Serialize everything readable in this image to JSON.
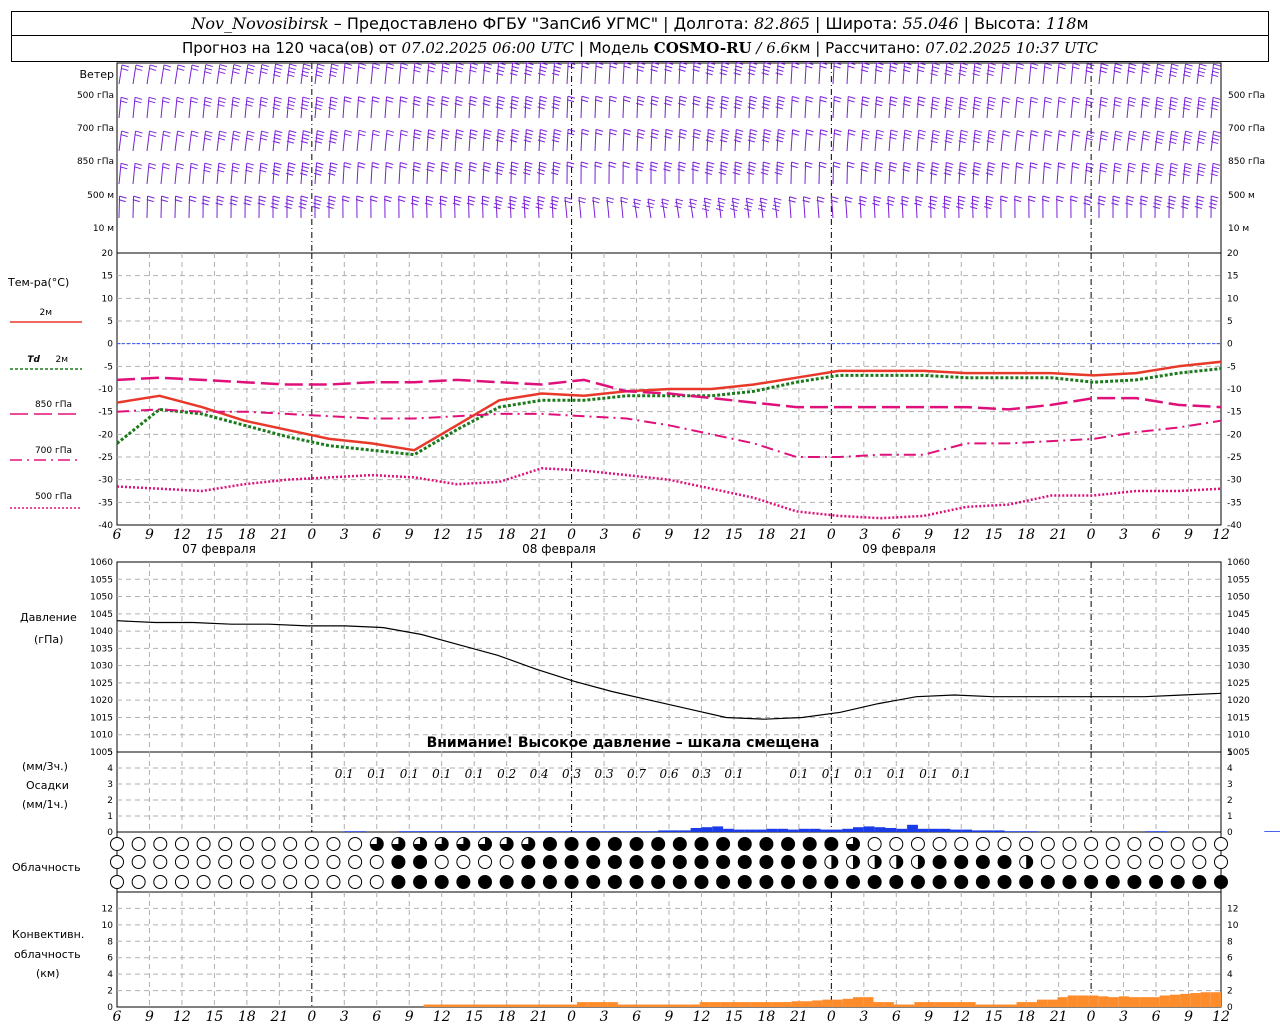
{
  "header": {
    "station": "Nov_Novosibirsk",
    "provider": "– Предоставлено ФГБУ \"ЗапСиб УГМС\"",
    "lon_label": "| Долгота:",
    "lon_value": "82.865",
    "lat_label": "| Широта:",
    "lat_value": "55.046",
    "alt_label": "| Высота:",
    "alt_value": "118",
    "alt_unit": "м",
    "forecast_label": "Прогноз на 120 часа(ов) от",
    "forecast_start": "07.02.2025 06:00 UTC",
    "model_label": "| Модель",
    "model_name": "COSMO-RU",
    "model_res": "/ 6.6",
    "model_res_unit": "км",
    "calc_label": "| Рассчитано:",
    "calc_time": "07.02.2025 10:37 UTC"
  },
  "wind_labels": {
    "title": "Ветер",
    "levels": [
      "500 гПа",
      "700 гПа",
      "850 гПа",
      "500 м",
      "10 м"
    ]
  },
  "temp_labels": {
    "title": "Тем-ра(°C)",
    "t2m": "2м",
    "td_prefix": "Td",
    "td2m": "2м",
    "l850": "850 гПа",
    "l700": "700 гПа",
    "l500": "500 гПа"
  },
  "pressure_labels": {
    "title": "Давление",
    "unit": "(гПа)",
    "warning": "Внимание! Высокое давление – шкала смещена"
  },
  "precip_labels": {
    "unit3h": "(мм/3ч.)",
    "title": "Осадки",
    "unit1h": "(мм/1ч.)"
  },
  "cloud_labels": {
    "title": "Облачность"
  },
  "conv_labels": {
    "line1": "Конвективн.",
    "line2": "облачность",
    "line3": "(км)"
  },
  "dates": [
    "07 февраля",
    "08 февраля",
    "09 февраля"
  ],
  "colors": {
    "t2m": "#e8382a",
    "td2m": "#1b7a1b",
    "l850": "#e0107a",
    "l700": "#e0107a",
    "l500": "#e0107a",
    "wind": "#7a1fd6",
    "precip": "#1a3ce8",
    "conv": "#ff8c2a",
    "zero_line": "#3050ff"
  },
  "chart_data": [
    {
      "type": "line",
      "id": "temperature",
      "x": [
        6,
        9,
        12,
        15,
        18,
        21,
        24,
        27,
        30,
        33,
        36,
        39,
        42,
        45,
        48,
        51,
        54,
        57,
        60,
        63,
        66,
        69,
        72,
        75,
        78,
        81,
        84,
        87,
        90,
        93,
        96,
        99,
        102,
        105,
        108
      ],
      "x_ticks": [
        "6",
        "9",
        "12",
        "15",
        "18",
        "21",
        "0",
        "3",
        "6",
        "9",
        "12",
        "15",
        "18",
        "21",
        "0",
        "3",
        "6",
        "9",
        "12",
        "15",
        "18",
        "21",
        "0",
        "3",
        "6",
        "9",
        "12",
        "15",
        "18",
        "21",
        "0",
        "3",
        "6",
        "9",
        "12"
      ],
      "ylim": [
        -40,
        20
      ],
      "y_ticks": [
        20,
        15,
        10,
        5,
        0,
        -5,
        -10,
        -15,
        -20,
        -25,
        -30,
        -35,
        -40
      ],
      "series": [
        {
          "name": "2м",
          "values": [
            -13,
            -11.5,
            -14,
            -17,
            -19,
            -21,
            -22,
            -23.5,
            -18,
            -12.5,
            -11,
            -11.5,
            -10.5,
            -10,
            -10,
            -9,
            -7.5,
            -6,
            -6,
            -6,
            -6.5,
            -6.5,
            -6.5,
            -7,
            -6.5,
            -5,
            -4
          ]
        },
        {
          "name": "Td 2м",
          "values": [
            -22,
            -14.5,
            -15.5,
            -18,
            -20.5,
            -22.5,
            -23.5,
            -24.5,
            -19,
            -14,
            -12.5,
            -12.5,
            -11.5,
            -11.5,
            -11.5,
            -10.5,
            -8.5,
            -7,
            -7,
            -7,
            -7.5,
            -7.5,
            -7.5,
            -8.5,
            -8,
            -6.5,
            -5.5
          ]
        },
        {
          "name": "850 гПа",
          "values": [
            -8,
            -7.5,
            -8,
            -8.5,
            -9,
            -9,
            -8.5,
            -8.5,
            -8,
            -8.5,
            -9,
            -8,
            -10.5,
            -11,
            -12,
            -13,
            -14,
            -14,
            -14,
            -14,
            -14,
            -14.5,
            -13.5,
            -12,
            -12,
            -13.5,
            -14
          ]
        },
        {
          "name": "700 гПа",
          "values": [
            -15,
            -14.5,
            -15,
            -15,
            -15.5,
            -16,
            -16.5,
            -16.5,
            -16,
            -15.5,
            -15.5,
            -16,
            -16.5,
            -18,
            -20,
            -22,
            -25,
            -25,
            -24.5,
            -24.5,
            -22,
            -22,
            -21.5,
            -21,
            -19.5,
            -18.5,
            -17
          ]
        },
        {
          "name": "500 гПа",
          "values": [
            -31.5,
            -32,
            -32.5,
            -31,
            -30,
            -29.5,
            -29,
            -29.5,
            -31,
            -30.5,
            -27.5,
            -28,
            -29,
            -30,
            -32,
            -34,
            -37,
            -38,
            -38.5,
            -38,
            -36,
            -35.5,
            -33.5,
            -33.5,
            -32.5,
            -32.5,
            -32
          ]
        }
      ]
    },
    {
      "type": "line",
      "id": "pressure",
      "ylim": [
        1005,
        1060
      ],
      "y_ticks": [
        1060,
        1055,
        1050,
        1045,
        1040,
        1035,
        1030,
        1025,
        1020,
        1015,
        1010,
        1005
      ],
      "x": [
        6,
        9,
        12,
        15,
        18,
        21,
        24,
        27,
        30,
        33,
        36,
        39,
        42,
        45,
        48,
        51,
        54,
        57,
        60,
        63,
        66,
        69,
        72,
        75,
        78,
        81,
        84,
        87,
        90,
        93,
        96,
        99,
        102,
        105,
        108
      ],
      "values": [
        1043,
        1042.5,
        1042.5,
        1042,
        1042,
        1041.5,
        1041.5,
        1041,
        1039,
        1036,
        1033,
        1029,
        1025.5,
        1022.5,
        1020,
        1017.5,
        1015,
        1014.5,
        1015,
        1016.5,
        1019,
        1021,
        1021.5,
        1021,
        1021,
        1021,
        1021,
        1021,
        1021.5,
        1022
      ]
    },
    {
      "type": "bar",
      "id": "precipitation",
      "ylim": [
        0,
        5
      ],
      "y_ticks": [
        5,
        4,
        3,
        2,
        1,
        0
      ],
      "labels_3h": [
        {
          "x": 27,
          "value": "0.1"
        },
        {
          "x": 30,
          "value": "0.1"
        },
        {
          "x": 33,
          "value": "0.1"
        },
        {
          "x": 36,
          "value": "0.1"
        },
        {
          "x": 39,
          "value": "0.1"
        },
        {
          "x": 42,
          "value": "0.2"
        },
        {
          "x": 45,
          "value": "0.4"
        },
        {
          "x": 48,
          "value": "0.3"
        },
        {
          "x": 51,
          "value": "0.3"
        },
        {
          "x": 54,
          "value": "0.7"
        },
        {
          "x": 57,
          "value": "0.6"
        },
        {
          "x": 60,
          "value": "0.3"
        },
        {
          "x": 63,
          "value": "0.1"
        },
        {
          "x": 69,
          "value": "0.1"
        },
        {
          "x": 72,
          "value": "0.1"
        },
        {
          "x": 75,
          "value": "0.1"
        },
        {
          "x": 78,
          "value": "0.1"
        },
        {
          "x": 81,
          "value": "0.1"
        },
        {
          "x": 84,
          "value": "0.1"
        }
      ],
      "hourly_mm": [
        0,
        0,
        0,
        0,
        0,
        0,
        0,
        0,
        0,
        0,
        0,
        0,
        0,
        0,
        0,
        0,
        0,
        0,
        0,
        0,
        0,
        0.05,
        0.05,
        0,
        0,
        0,
        0.05,
        0.05,
        0.05,
        0.05,
        0.05,
        0.05,
        0.05,
        0.05,
        0.05,
        0.05,
        0.05,
        0.05,
        0.05,
        0.05,
        0.05,
        0.05,
        0.05,
        0.05,
        0.05,
        0.05,
        0.05,
        0.05,
        0.05,
        0.05,
        0.1,
        0.1,
        0.1,
        0.25,
        0.3,
        0.35,
        0.2,
        0.15,
        0.15,
        0.15,
        0.2,
        0.2,
        0.15,
        0.2,
        0.2,
        0.15,
        0.15,
        0.2,
        0.3,
        0.35,
        0.3,
        0.25,
        0.2,
        0.45,
        0.2,
        0.2,
        0.2,
        0.15,
        0.15,
        0.1,
        0.1,
        0.1,
        0.05,
        0.05,
        0.05,
        0,
        0,
        0,
        0,
        0,
        0,
        0,
        0,
        0,
        0,
        0.05,
        0.05,
        0,
        0,
        0,
        0,
        0,
        0,
        0,
        0,
        0,
        0.05,
        0.05,
        0.05,
        0.05,
        0.05,
        0.05,
        0.05,
        0,
        0,
        0.05,
        0.05,
        0,
        0,
        0,
        0,
        0,
        0.05,
        0.05
      ]
    },
    {
      "type": "table",
      "id": "cloudiness",
      "rows": [
        {
          "name": "high",
          "values": "000000000000000000033333333333334444444444444442444444443000000000000000000000000000000"
        },
        {
          "name": "middle",
          "values": "000000000000000000000004440000000444444444444444444444444442222222244444444200000000000000002"
        },
        {
          "name": "low",
          "values": "000000000000000000000444444444444444444444444444444444444444444444444444444444444444444444"
        }
      ]
    },
    {
      "type": "bar",
      "id": "convective_cloudiness",
      "ylim": [
        0,
        14
      ],
      "y_ticks": [
        12,
        10,
        8,
        6,
        4,
        2,
        0
      ],
      "values": [
        0,
        0,
        0,
        0,
        0,
        0,
        0,
        0,
        0,
        0,
        0,
        0,
        0,
        0,
        0,
        0,
        0,
        0,
        0,
        0,
        0,
        0,
        0,
        0,
        0,
        0,
        0,
        0,
        0,
        0,
        0.3,
        0.3,
        0.3,
        0.3,
        0.3,
        0.3,
        0.3,
        0.3,
        0.3,
        0.3,
        0.3,
        0.3,
        0.3,
        0.3,
        0.3,
        0.6,
        0.6,
        0.6,
        0.6,
        0.3,
        0.3,
        0.3,
        0.3,
        0.3,
        0.3,
        0.3,
        0.3,
        0.6,
        0.6,
        0.6,
        0.6,
        0.6,
        0.6,
        0.6,
        0.6,
        0.6,
        0.7,
        0.7,
        0.8,
        0.9,
        0.9,
        1.0,
        1.2,
        1.2,
        0.6,
        0.6,
        0.3,
        0.3,
        0.6,
        0.6,
        0.6,
        0.6,
        0.6,
        0.6,
        0.3,
        0.3,
        0.3,
        0.3,
        0.6,
        0.6,
        0.9,
        0.9,
        1.2,
        1.4,
        1.4,
        1.4,
        1.3,
        1.2,
        1.3,
        1.2,
        1.2,
        1.2,
        1.4,
        1.5,
        1.6,
        1.7,
        1.8,
        1.8
      ]
    }
  ]
}
